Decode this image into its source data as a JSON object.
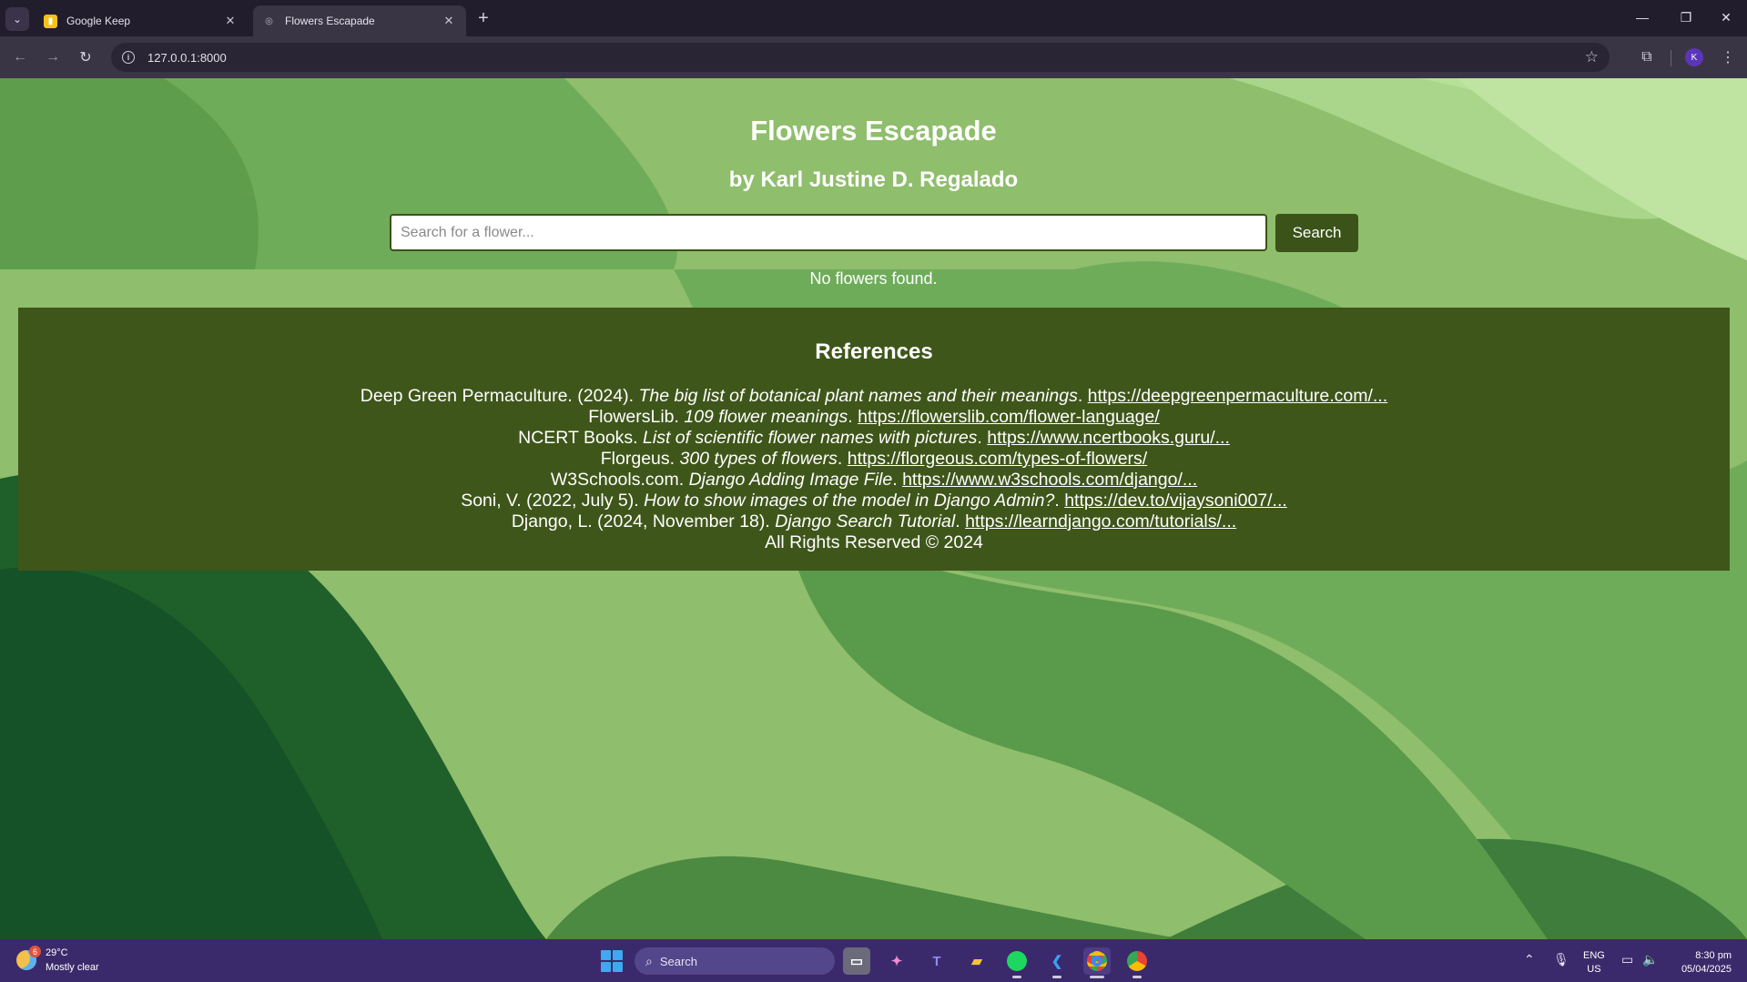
{
  "browser": {
    "tabs": [
      {
        "title": "Google Keep",
        "icon": "google-keep-icon",
        "active": false
      },
      {
        "title": "Flowers Escapade",
        "icon": "globe-icon",
        "active": true
      }
    ],
    "url": "127.0.0.1:8000",
    "profile_initial": "K"
  },
  "page": {
    "title": "Flowers Escapade",
    "subtitle": "by Karl Justine D. Regalado",
    "search": {
      "placeholder": "Search for a flower...",
      "value": "",
      "button_label": "Search"
    },
    "no_results": "No flowers found.",
    "references": {
      "heading": "References",
      "items": [
        {
          "prefix": "Deep Green Permaculture. (2024). ",
          "title": "The big list of botanical plant names and their meanings",
          "sep": ". ",
          "link": "https://deepgreenpermaculture.com/..."
        },
        {
          "prefix": "FlowersLib. ",
          "title": "109 flower meanings",
          "sep": ". ",
          "link": "https://flowerslib.com/flower-language/"
        },
        {
          "prefix": "NCERT Books. ",
          "title": "List of scientific flower names with pictures",
          "sep": ". ",
          "link": "https://www.ncertbooks.guru/..."
        },
        {
          "prefix": "Florgeus. ",
          "title": "300 types of flowers",
          "sep": ". ",
          "link": "https://florgeous.com/types-of-flowers/"
        },
        {
          "prefix": "W3Schools.com. ",
          "title": "Django Adding Image File",
          "sep": ". ",
          "link": "https://www.w3schools.com/django/..."
        },
        {
          "prefix": "Soni, V. (2022, July 5). ",
          "title": "How to show images of the model in Django Admin?",
          "sep": ". ",
          "link": "https://dev.to/vijaysoni007/..."
        },
        {
          "prefix": "Django, L. (2024, November 18). ",
          "title": "Django Search Tutorial",
          "sep": ". ",
          "link": "https://learndjango.com/tutorials/..."
        }
      ],
      "copyright": "All Rights Reserved © 2024"
    }
  },
  "taskbar": {
    "weather": {
      "temp": "29°C",
      "desc": "Mostly clear",
      "badge": "6"
    },
    "search_label": "Search",
    "apps": [
      "task-view-icon",
      "copilot-icon",
      "teams-icon",
      "file-explorer-icon",
      "spotify-icon",
      "vscode-icon",
      "chrome-icon",
      "chrome-profile-icon"
    ],
    "lang": {
      "line1": "ENG",
      "line2": "US"
    },
    "clock": {
      "time": "8:30 pm",
      "date": "05/04/2025"
    }
  },
  "colors": {
    "page_bg": "#8fbe6c",
    "references_bg": "#3f561a",
    "button_bg": "#3b5218",
    "taskbar_bg": "#3b2a6b"
  }
}
